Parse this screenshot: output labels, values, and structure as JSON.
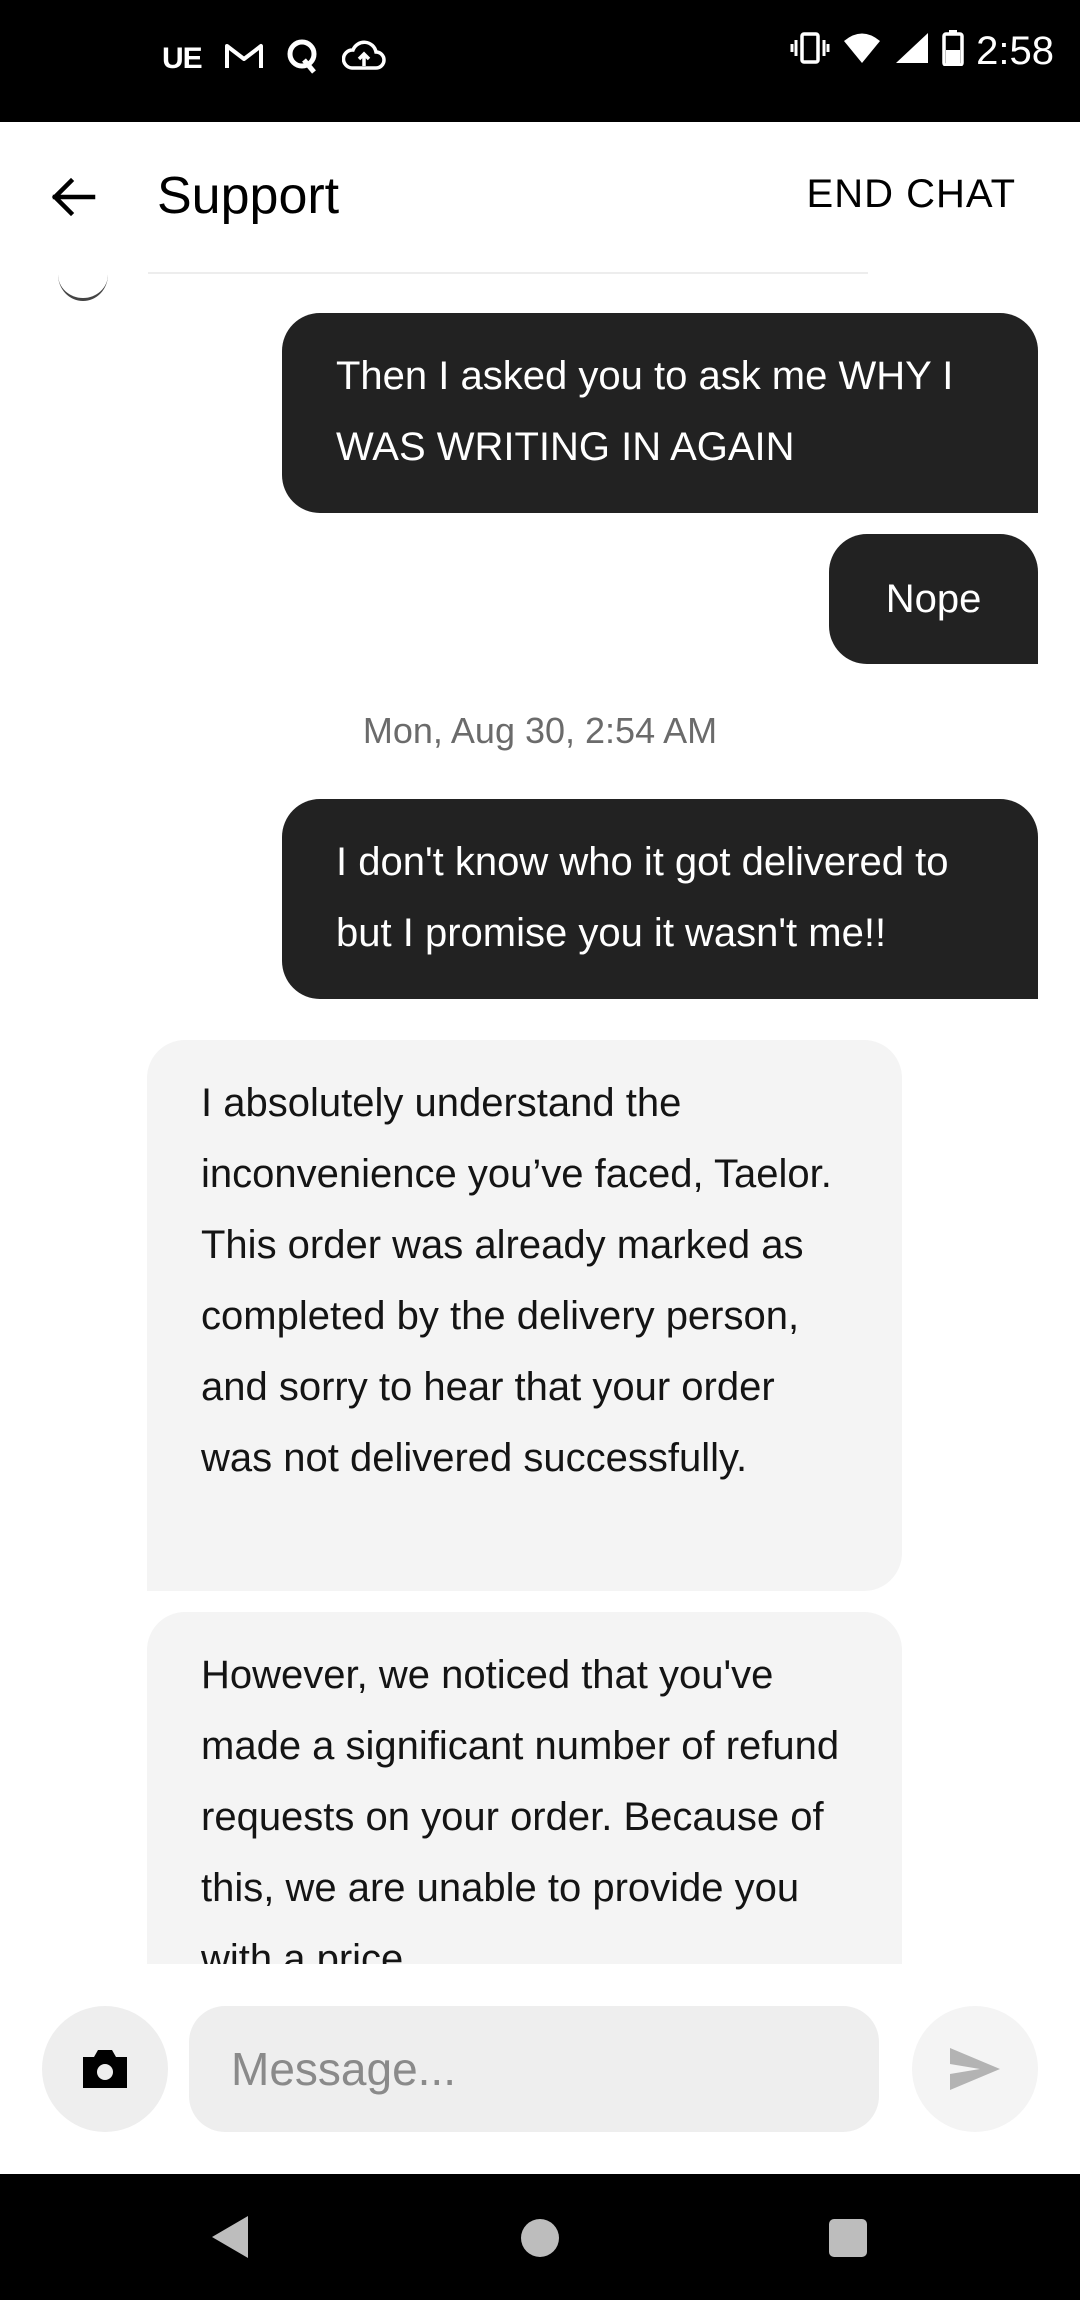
{
  "status_bar": {
    "app_icons": [
      "uber-eats-icon",
      "gmail-icon",
      "quora-icon",
      "cloud-upload-icon"
    ],
    "ue_label": "UE",
    "right_icons": [
      "vibrate-icon",
      "wifi-icon",
      "signal-icon",
      "battery-icon"
    ],
    "time": "2:58"
  },
  "header": {
    "title": "Support",
    "end_chat_label": "END CHAT"
  },
  "messages": [
    {
      "from": "user",
      "text": "Then I asked you to ask me WHY I WAS WRITING IN AGAIN"
    },
    {
      "from": "user",
      "text": "Nope"
    },
    {
      "type": "timestamp",
      "text": "Mon, Aug 30, 2:54 AM"
    },
    {
      "from": "user",
      "text": "I don't know who it got delivered to but I promise you it wasn't me!!"
    },
    {
      "from": "support",
      "text": "I absolutely understand the inconvenience you’ve faced, Taelor. This order was already marked as completed by the delivery person, and sorry to hear that your order was not delivered successfully."
    },
    {
      "from": "support",
      "text": "However, we noticed that you've made a significant number of refund requests on your order. Because of this, we are unable to provide you with a price"
    }
  ],
  "composer": {
    "placeholder": "Message...",
    "value": ""
  },
  "colors": {
    "outgoing_bubble": "#222222",
    "incoming_bubble": "#f4f4f4",
    "timestamp": "#6b6b6b"
  }
}
